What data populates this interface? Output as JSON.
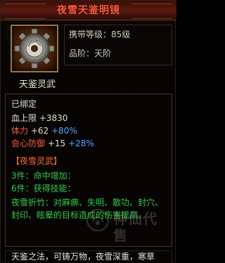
{
  "title": "夜雪天鉴明镜",
  "item_icon": "gear-mirror-icon",
  "info": {
    "level_label": "携带等级：",
    "level_value": "85级",
    "rank_label": "品阶：",
    "rank_value": "天阶"
  },
  "subtitle": "天鉴灵武",
  "stats": {
    "bound": "已绑定",
    "hp_label": "血上限",
    "hp_value": "+3830",
    "stamina_label": "体力",
    "stamina_value": "+62",
    "stamina_pct": "+80%",
    "defense_label": "会心防御",
    "defense_value": "+15",
    "defense_pct": "+28%"
  },
  "set": {
    "title": "【夜雪灵武】",
    "piece3": "3件：命中增加：",
    "piece6": "6件：获得技能：",
    "desc": "夜雪折竹：对麻痹、失明、散功、封穴、封印、眩晕的目标造成的伤害提高。"
  },
  "footer": "天鉴之法，可铸万物，夜雪深重，寒草",
  "watermark": "神仙代售",
  "colors": {
    "title": "#ff5a3c",
    "set_title": "#ff6a2c",
    "set_text": "#34c84a",
    "pct": "#4fa7ff"
  }
}
